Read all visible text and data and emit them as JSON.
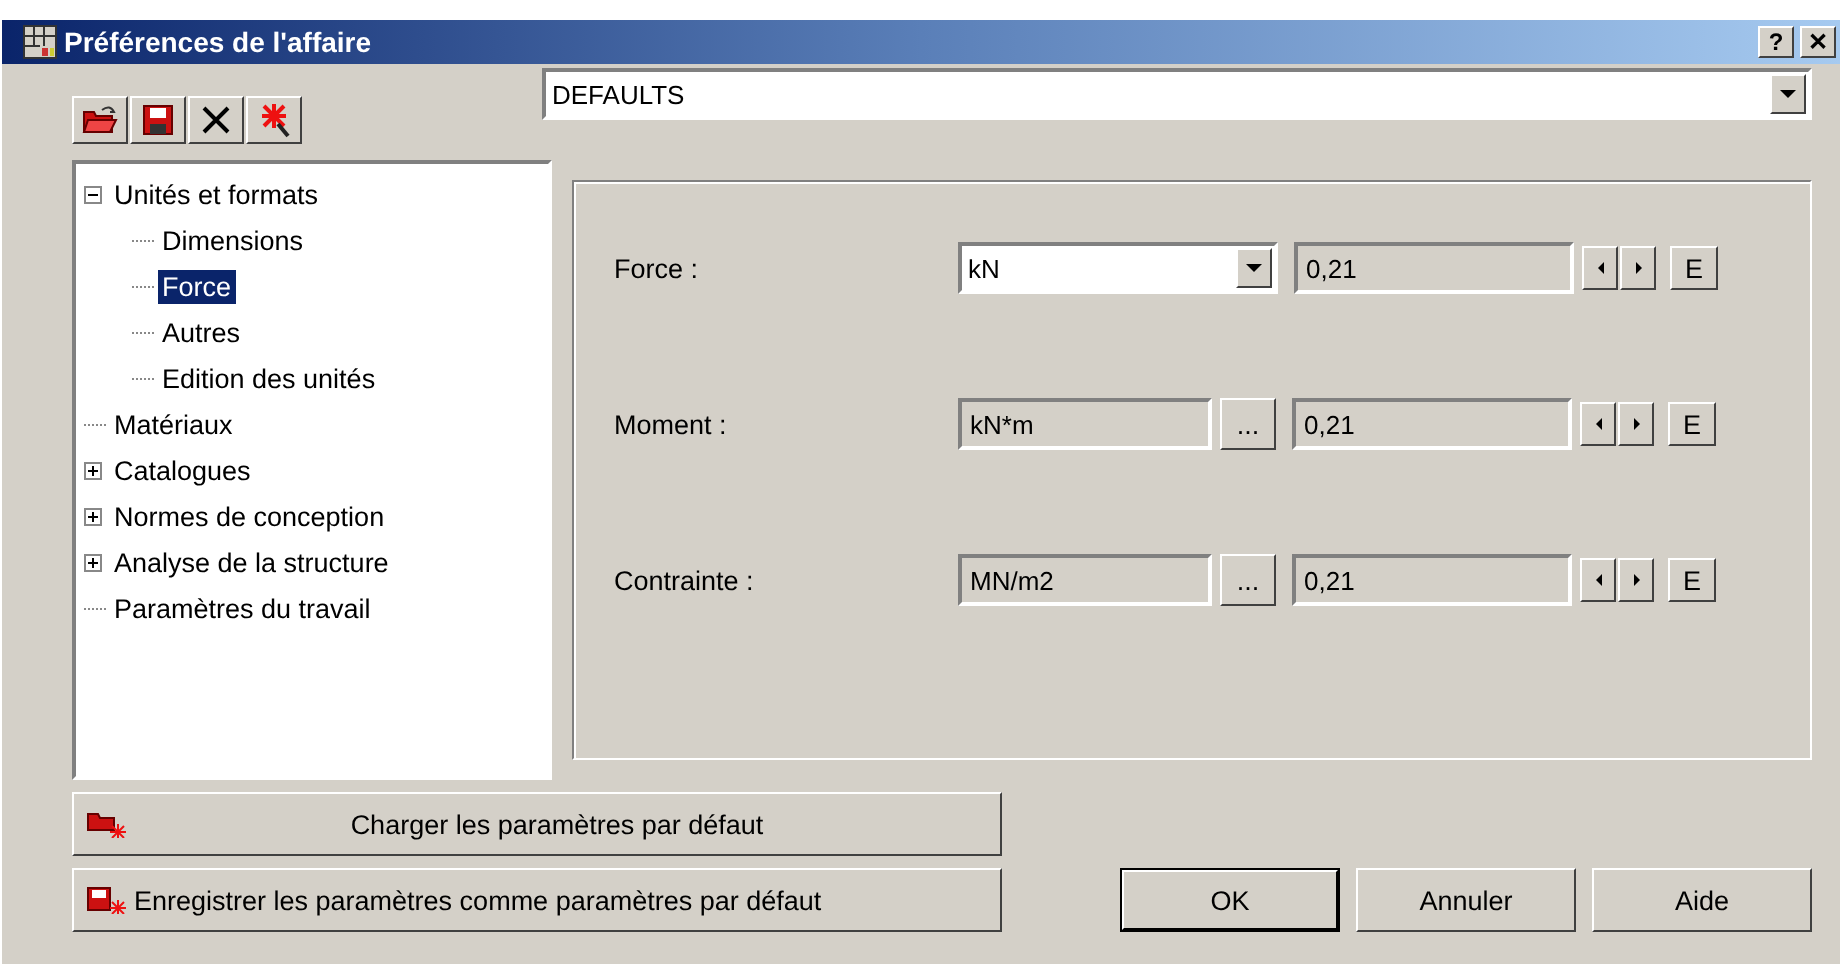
{
  "window": {
    "title": "Préférences de l'affaire",
    "help_button": "?",
    "close_button": "✕"
  },
  "profile": {
    "value": "DEFAULTS"
  },
  "tree": [
    {
      "label": "Unités et formats",
      "expanded": true,
      "selected": false,
      "children": [
        {
          "label": "Dimensions",
          "selected": false
        },
        {
          "label": "Force",
          "selected": true
        },
        {
          "label": "Autres",
          "selected": false
        },
        {
          "label": "Edition des unités",
          "selected": false
        }
      ]
    },
    {
      "label": "Matériaux",
      "selected": false
    },
    {
      "label": "Catalogues",
      "expanded": false,
      "selected": false
    },
    {
      "label": "Normes de conception",
      "expanded": false,
      "selected": false
    },
    {
      "label": "Analyse de la structure",
      "expanded": false,
      "selected": false
    },
    {
      "label": "Paramètres du travail",
      "selected": false
    }
  ],
  "units": [
    {
      "label": "Force :",
      "kind": "dropdown",
      "unit": "kN",
      "value": "0,21",
      "edit_button": "E"
    },
    {
      "label": "Moment :",
      "kind": "browse",
      "unit": "kN*m",
      "browse_button": "...",
      "value": "0,21",
      "edit_button": "E"
    },
    {
      "label": "Contrainte :",
      "kind": "browse",
      "unit": "MN/m2",
      "browse_button": "...",
      "value": "0,21",
      "edit_button": "E"
    }
  ],
  "load_defaults_button": "Charger les paramètres par défaut",
  "save_defaults_button": "Enregistrer les paramètres comme paramètres par défaut",
  "buttons": [
    "OK",
    "Annuler",
    "Aide"
  ]
}
